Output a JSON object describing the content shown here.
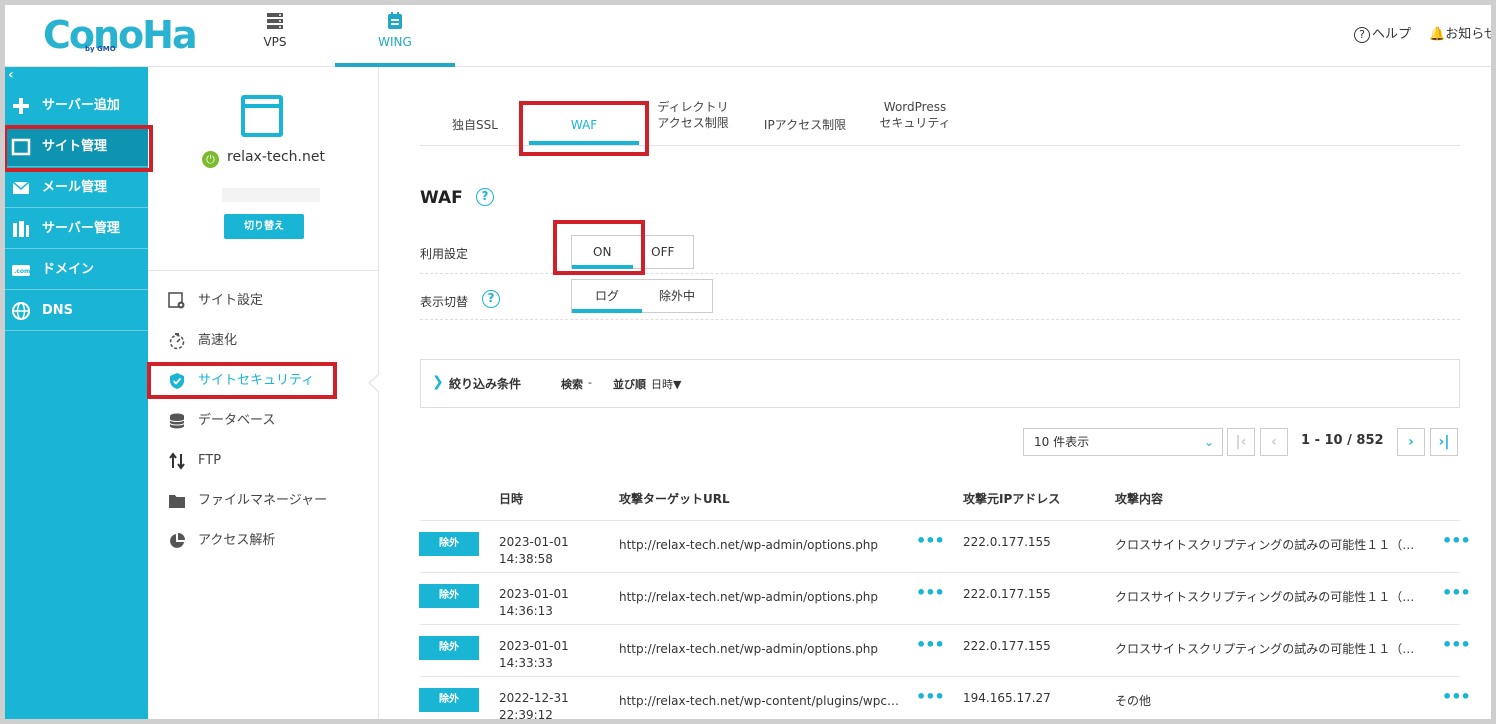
{
  "header": {
    "logo": "ConoHa",
    "logo_sub": "by GMO",
    "nav": [
      {
        "label": "VPS"
      },
      {
        "label": "WING"
      }
    ],
    "help": "ヘルプ",
    "notice": "お知らせ"
  },
  "sidebar": {
    "collapse": "‹",
    "items": [
      {
        "label": "サーバー追加",
        "icon": "plus-icon"
      },
      {
        "label": "サイト管理",
        "icon": "window-icon"
      },
      {
        "label": "メール管理",
        "icon": "mail-icon"
      },
      {
        "label": "サーバー管理",
        "icon": "server-icon"
      },
      {
        "label": "ドメイン",
        "icon": "domain-icon"
      },
      {
        "label": "DNS",
        "icon": "globe-icon"
      }
    ]
  },
  "site": {
    "domain": "relax-tech.net",
    "switch_label": "切り替え",
    "menu": [
      {
        "label": "サイト設定"
      },
      {
        "label": "高速化"
      },
      {
        "label": "サイトセキュリティ"
      },
      {
        "label": "データベース"
      },
      {
        "label": "FTP"
      },
      {
        "label": "ファイルマネージャー"
      },
      {
        "label": "アクセス解析"
      }
    ]
  },
  "tabs": [
    {
      "label": "独自SSL"
    },
    {
      "label": "WAF"
    },
    {
      "line1": "ディレクトリ",
      "line2": "アクセス制限"
    },
    {
      "label": "IPアクセス制限"
    },
    {
      "line1": "WordPress",
      "line2": "セキュリティ"
    }
  ],
  "waf": {
    "title": "WAF",
    "usage_label": "利用設定",
    "usage_on": "ON",
    "usage_off": "OFF",
    "view_label": "表示切替",
    "view_log": "ログ",
    "view_excluded": "除外中"
  },
  "filter": {
    "label": "絞り込み条件",
    "search_label": "検索",
    "search_value": "-",
    "sort_label": "並び順",
    "sort_value": "日時▼"
  },
  "pagination": {
    "per_page": "10 件表示",
    "range": "1 - 10",
    "total": "852"
  },
  "table": {
    "headers": [
      "日時",
      "攻撃ターゲットURL",
      "攻撃元IPアドレス",
      "攻撃内容"
    ],
    "exclude_label": "除外",
    "rows": [
      {
        "date": "2023-01-01",
        "time": "14:38:58",
        "url": "http://relax-tech.net/wp-admin/options.php",
        "ip": "222.0.177.155",
        "attack": "クロスサイトスクリプティングの試みの可能性１１（{{…"
      },
      {
        "date": "2023-01-01",
        "time": "14:36:13",
        "url": "http://relax-tech.net/wp-admin/options.php",
        "ip": "222.0.177.155",
        "attack": "クロスサイトスクリプティングの試みの可能性１１（{{…"
      },
      {
        "date": "2023-01-01",
        "time": "14:33:33",
        "url": "http://relax-tech.net/wp-admin/options.php",
        "ip": "222.0.177.155",
        "attack": "クロスサイトスクリプティングの試みの可能性１１（{{…"
      },
      {
        "date": "2022-12-31",
        "time": "22:39:12",
        "url": "http://relax-tech.net/wp-content/plugins/wpc…",
        "ip": "194.165.17.27",
        "attack": "その他"
      }
    ]
  },
  "colors": {
    "accent": "#1ab5d5",
    "sidebar": "#1ab5d5",
    "highlight_box": "#d0202a",
    "power": "#7cbb2e"
  }
}
